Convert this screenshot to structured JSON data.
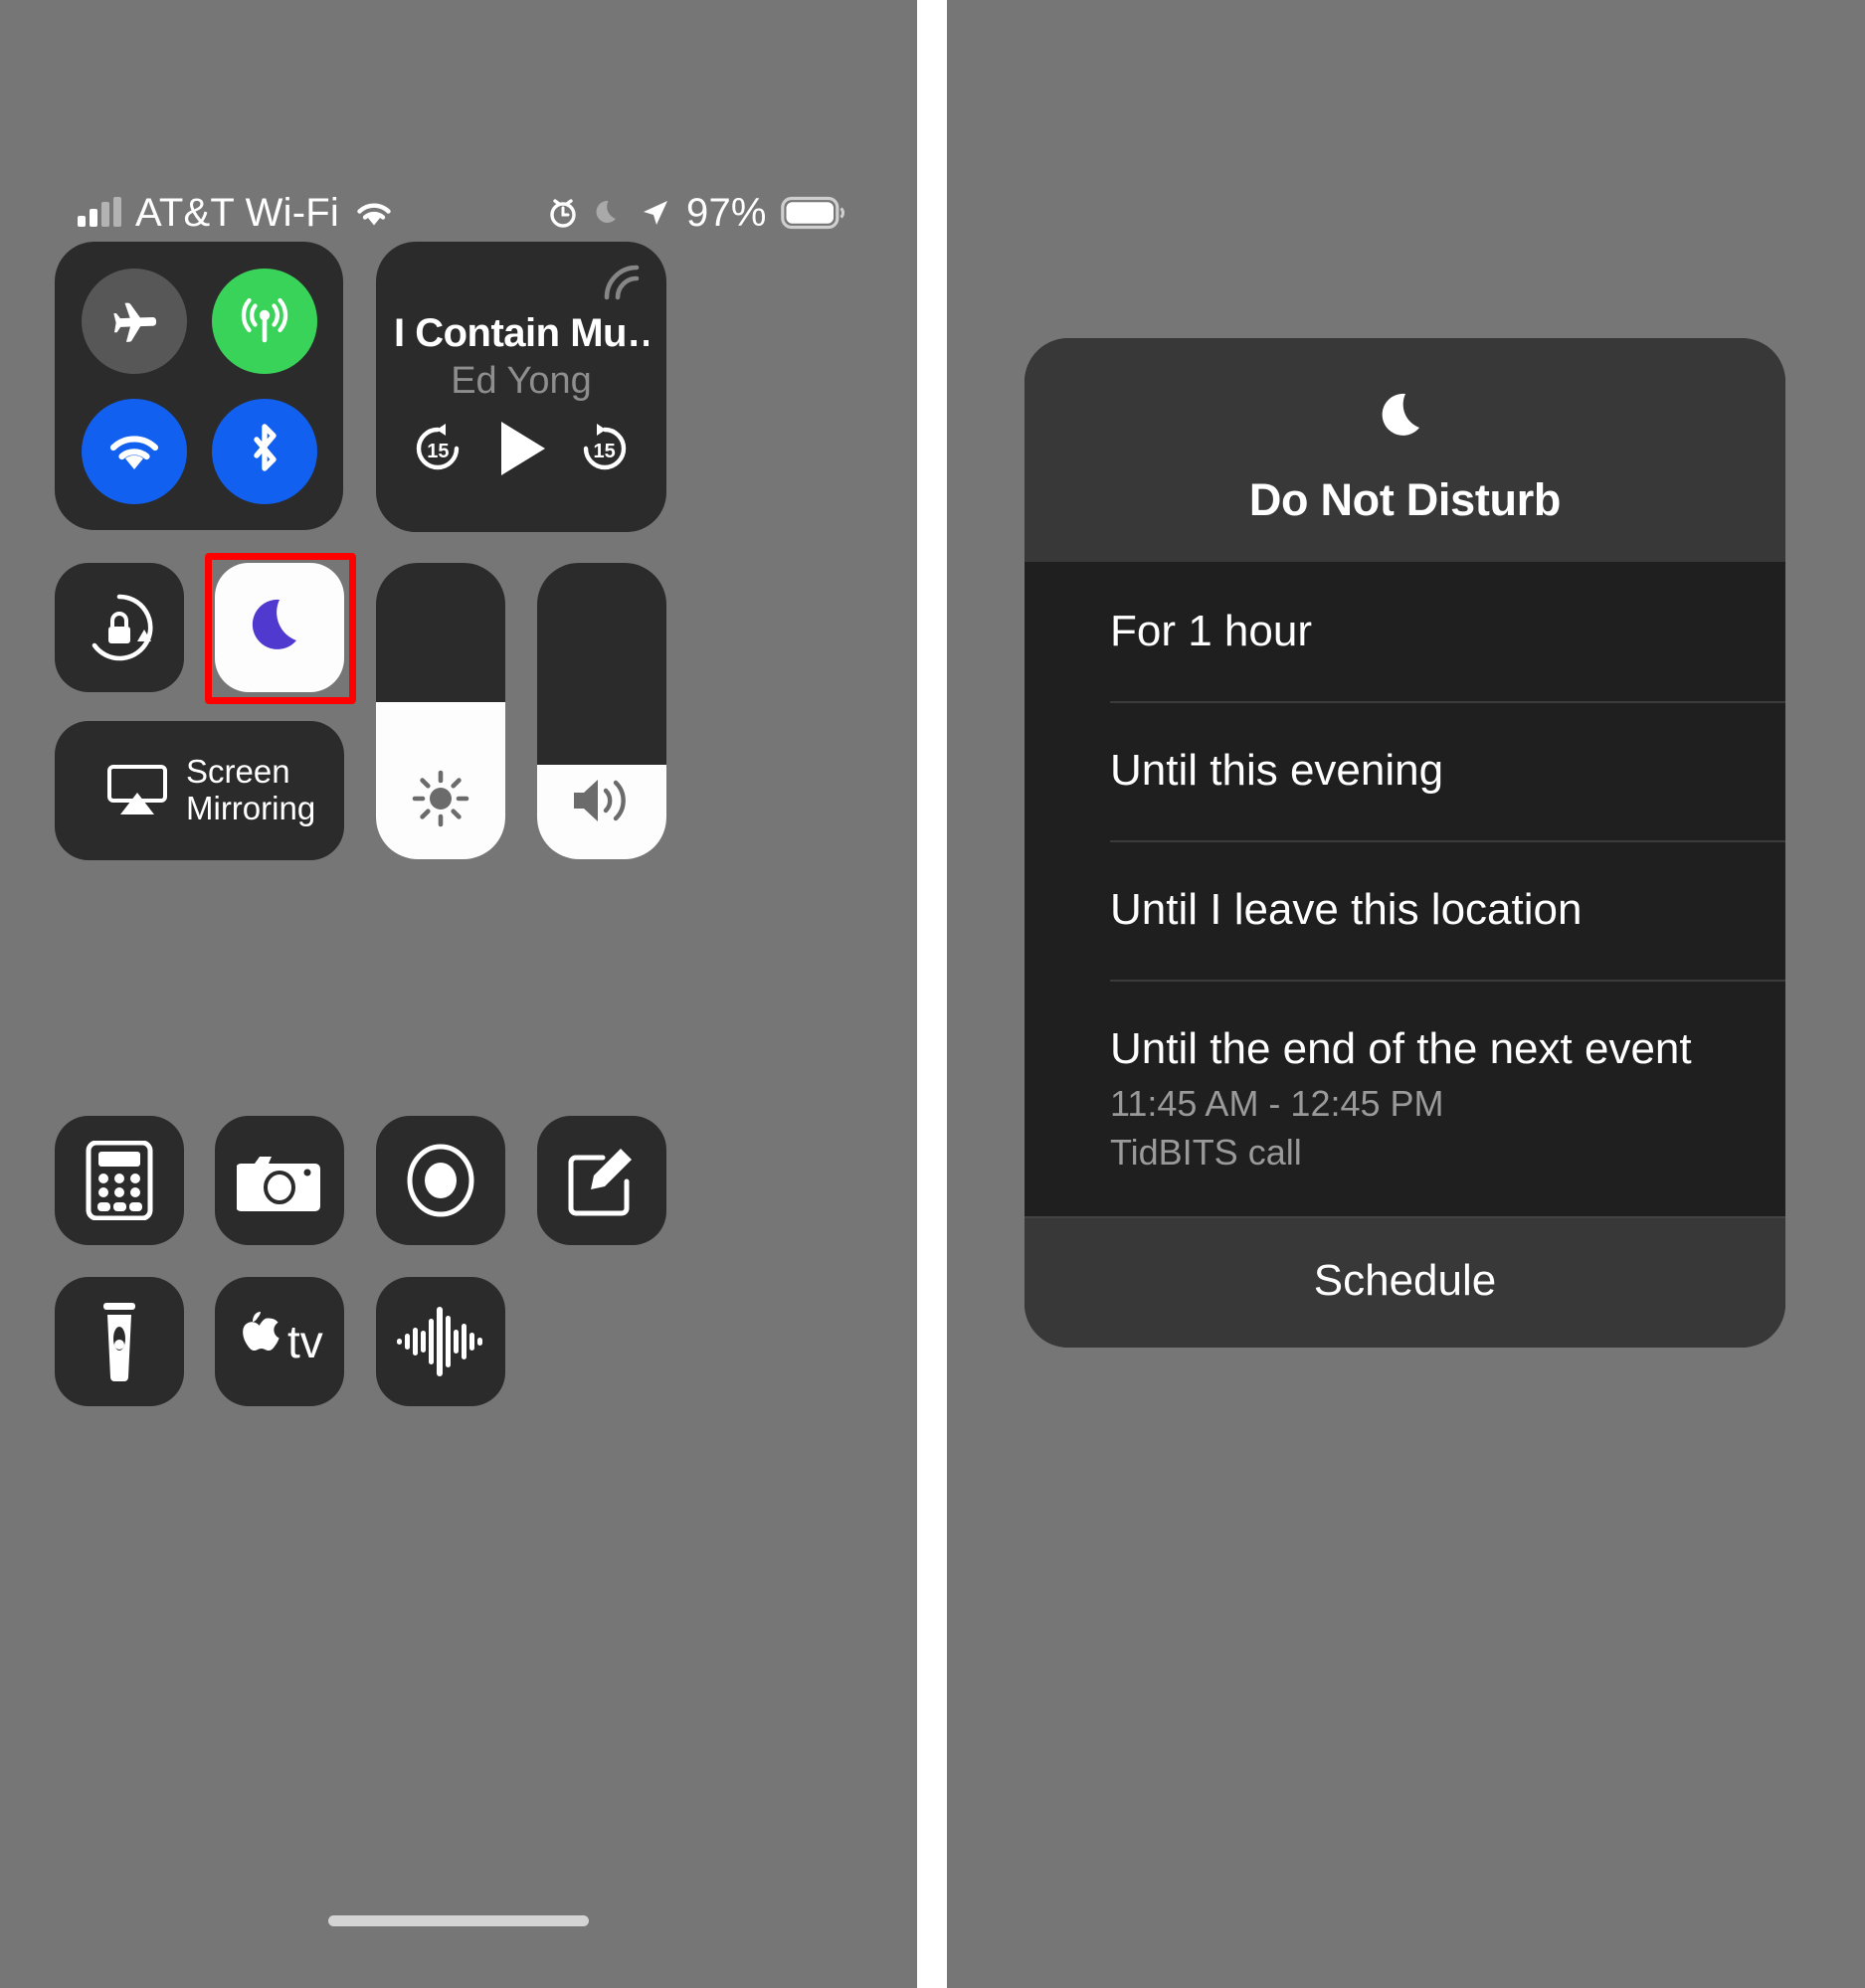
{
  "status_bar": {
    "carrier": "AT&T Wi-Fi",
    "battery_percent": "97%",
    "icons": [
      "signal-bars-icon",
      "wifi-icon",
      "alarm-clock-icon",
      "moon-icon",
      "location-arrow-icon",
      "battery-icon"
    ]
  },
  "control_center": {
    "connectivity": {
      "airplane_mode": {
        "icon": "airplane-icon",
        "state": "off",
        "color": "#575757"
      },
      "cellular_data": {
        "icon": "cellular-antenna-icon",
        "state": "on",
        "color": "#3ad35a"
      },
      "wifi": {
        "icon": "wifi-icon",
        "state": "on",
        "color": "#1160ef"
      },
      "bluetooth": {
        "icon": "bluetooth-icon",
        "state": "on",
        "color": "#1160ef"
      }
    },
    "media": {
      "title": "I Contain Mu…",
      "artist": "Ed Yong",
      "airplay_icon": "airplay-audio-icon",
      "skip_back_label": "15",
      "skip_forward_label": "15",
      "play_icon": "play-icon"
    },
    "rotation_lock": {
      "icon": "rotation-lock-icon",
      "state": "off"
    },
    "do_not_disturb_toggle": {
      "icon": "moon-icon",
      "state": "on",
      "tile_color": "#fdfdfd",
      "icon_color": "#5039cf",
      "highlight_color": "#fe0000"
    },
    "brightness_slider": {
      "icon": "brightness-sun-icon",
      "value_percent": 53
    },
    "volume_slider": {
      "icon": "speaker-waves-icon",
      "value_percent": 32
    },
    "screen_mirroring": {
      "icon": "airplay-video-icon",
      "line1": "Screen",
      "line2": "Mirroring"
    },
    "shortcuts": [
      {
        "icon": "calculator-icon"
      },
      {
        "icon": "camera-icon"
      },
      {
        "icon": "screen-record-icon"
      },
      {
        "icon": "notes-compose-icon"
      },
      {
        "icon": "flashlight-icon"
      },
      {
        "icon": "apple-tv-remote-icon"
      },
      {
        "icon": "voice-memos-icon"
      }
    ]
  },
  "dnd_sheet": {
    "icon": "moon-icon",
    "title": "Do Not Disturb",
    "options": [
      {
        "label": "For 1 hour"
      },
      {
        "label": "Until this evening"
      },
      {
        "label": "Until I leave this location"
      },
      {
        "label": "Until the end of the next event",
        "time": "11:45 AM - 12:45 PM",
        "event": "TidBITS call"
      }
    ],
    "footer_label": "Schedule"
  }
}
